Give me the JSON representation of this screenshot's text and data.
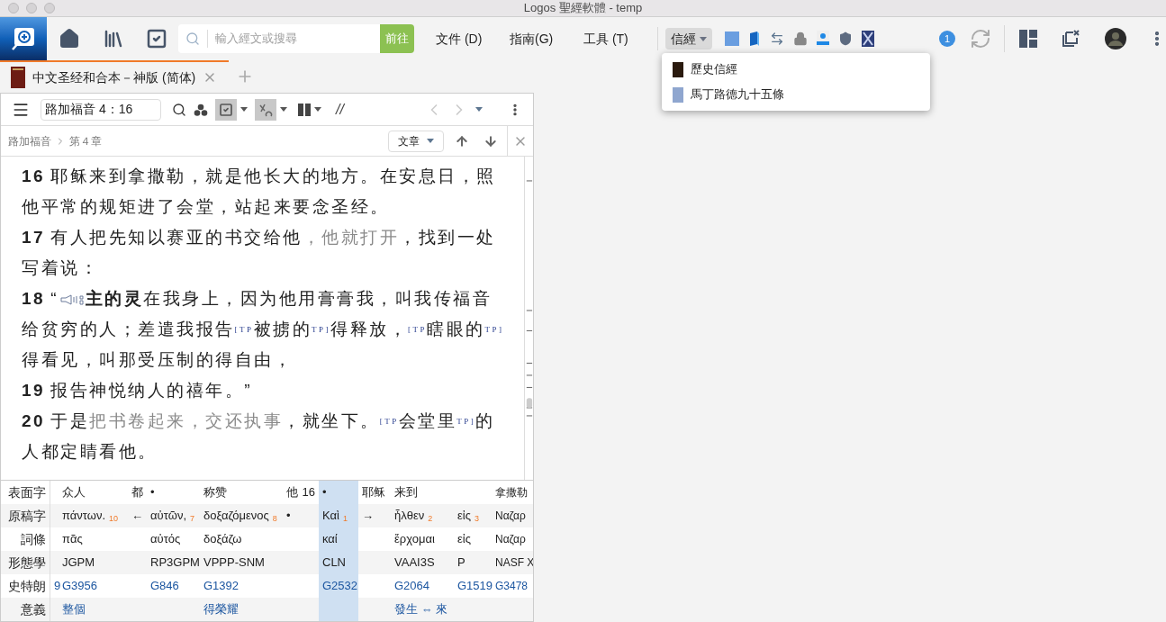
{
  "window": {
    "title": "Logos 聖經軟體 - temp"
  },
  "toolbar": {
    "search_placeholder": "輸入經文或搜尋",
    "go_button": "前往",
    "menus": [
      {
        "label": "文件 (D)",
        "selected": false
      },
      {
        "label": "指南(G)",
        "selected": false
      },
      {
        "label": "工具 (T)",
        "selected": false
      },
      {
        "label": "信經",
        "selected": true,
        "kind": "dropdown"
      }
    ],
    "notification_count": "1"
  },
  "dropdown": {
    "items": [
      {
        "label": "歷史信經",
        "color": "#2a1a0e"
      },
      {
        "label": "馬丁路德九十五條",
        "color": "#8fa6cf"
      }
    ]
  },
  "tab": {
    "title": "中文圣经和合本－神版 (简体)",
    "selected": true
  },
  "panel": {
    "reference": "路加福音 4：16",
    "divider_text": "//",
    "breadcrumb": [
      "路加福音",
      "第４章"
    ],
    "view_select": "文章",
    "toggles": [
      {
        "selected": true
      },
      {
        "selected": true
      }
    ]
  },
  "verses": [
    {
      "number": "16",
      "segments": [
        {
          "kind": "plain",
          "text": "耶稣来到拿撒勒，就是他长大的地方。在安息日，照他平常的规矩进了会堂，站起来要念圣经。"
        }
      ]
    },
    {
      "number": "17",
      "segments": [
        {
          "kind": "plain",
          "text": "有人把先知以赛亚的书交给他"
        },
        {
          "kind": "dim",
          "text": "，他就打开"
        },
        {
          "kind": "plain",
          "text": "，找到一处写着说："
        }
      ]
    },
    {
      "number": "18",
      "segments": [
        {
          "kind": "plain",
          "text": "“"
        },
        {
          "kind": "speaker"
        },
        {
          "kind": "bold",
          "text": "主的灵"
        },
        {
          "kind": "plain",
          "text": "在我身上，因为他用膏膏我，叫我传福音给贫穷的人；差遣我报告"
        },
        {
          "kind": "tag",
          "text": "[TP"
        },
        {
          "kind": "plain",
          "text": "被掳的"
        },
        {
          "kind": "tag",
          "text": "TP]"
        },
        {
          "kind": "plain",
          "text": "得释放，"
        },
        {
          "kind": "tag",
          "text": "[TP"
        },
        {
          "kind": "plain",
          "text": "瞎眼的"
        },
        {
          "kind": "tag",
          "text": "TP]"
        },
        {
          "kind": "plain",
          "text": "得看见，叫那受压制的得自由，"
        }
      ]
    },
    {
      "number": "19",
      "segments": [
        {
          "kind": "plain",
          "text": "报告神悦纳人的禧年。”"
        }
      ]
    },
    {
      "number": "20",
      "segments": [
        {
          "kind": "plain",
          "text": "于是"
        },
        {
          "kind": "dim",
          "text": "把书卷起来，交还执事"
        },
        {
          "kind": "plain",
          "text": "，就坐下。"
        },
        {
          "kind": "tag",
          "text": "[TP"
        },
        {
          "kind": "plain",
          "text": "会堂里"
        },
        {
          "kind": "tag",
          "text": "TP]"
        },
        {
          "kind": "plain",
          "text": "的人都定睛看他。"
        }
      ]
    }
  ],
  "interlinear": {
    "row_labels": [
      "表面字",
      "原稿字",
      "詞條",
      "形態學",
      "史特朗",
      "意義"
    ],
    "columns": [
      {
        "selected": false,
        "strongs": "9"
      },
      {
        "selected": false,
        "surface": "众人",
        "original": "πάντων.",
        "index": "10",
        "lemma": "πᾶς",
        "morph": "JGPM",
        "strongs": "G3956",
        "meaning": "整個"
      },
      {
        "selected": false,
        "surface": "都",
        "original": "←"
      },
      {
        "selected": false,
        "surface": "•",
        "original": "αὐτῶν,",
        "index": "7",
        "lemma": "αὐτός",
        "morph": "RP3GPM",
        "strongs": "G846"
      },
      {
        "selected": false,
        "surface": "称赞",
        "original": "δοξαζόμενος",
        "index": "8",
        "lemma": "δοξάζω",
        "morph": "VPPP-SNM",
        "strongs": "G1392",
        "meaning": "得榮耀"
      },
      {
        "selected": false,
        "surface": "他",
        "verse": "16",
        "original": "•"
      },
      {
        "selected": true,
        "surface": "•",
        "original": "Καὶ",
        "index": "1",
        "lemma": "καί",
        "morph": "CLN",
        "strongs": "G2532"
      },
      {
        "selected": false,
        "surface": "耶稣",
        "original": "→"
      },
      {
        "selected": false,
        "surface": "来到",
        "original": "ἦλθεν",
        "index": "2",
        "lemma": "ἔρχομαι",
        "morph": "VAAI3S",
        "strongs": "G2064",
        "meaning": "發生 ⇔ 來"
      },
      {
        "selected": false,
        "original": "εἰς",
        "index": "3",
        "lemma": "εἰς",
        "morph": "P",
        "strongs": "G1519"
      },
      {
        "selected": false,
        "surface": "拿撒勒",
        "original": "Ναζαρ",
        "lemma": "Ναζαρ",
        "morph": "NASF X",
        "strongs": "G3478"
      }
    ]
  }
}
